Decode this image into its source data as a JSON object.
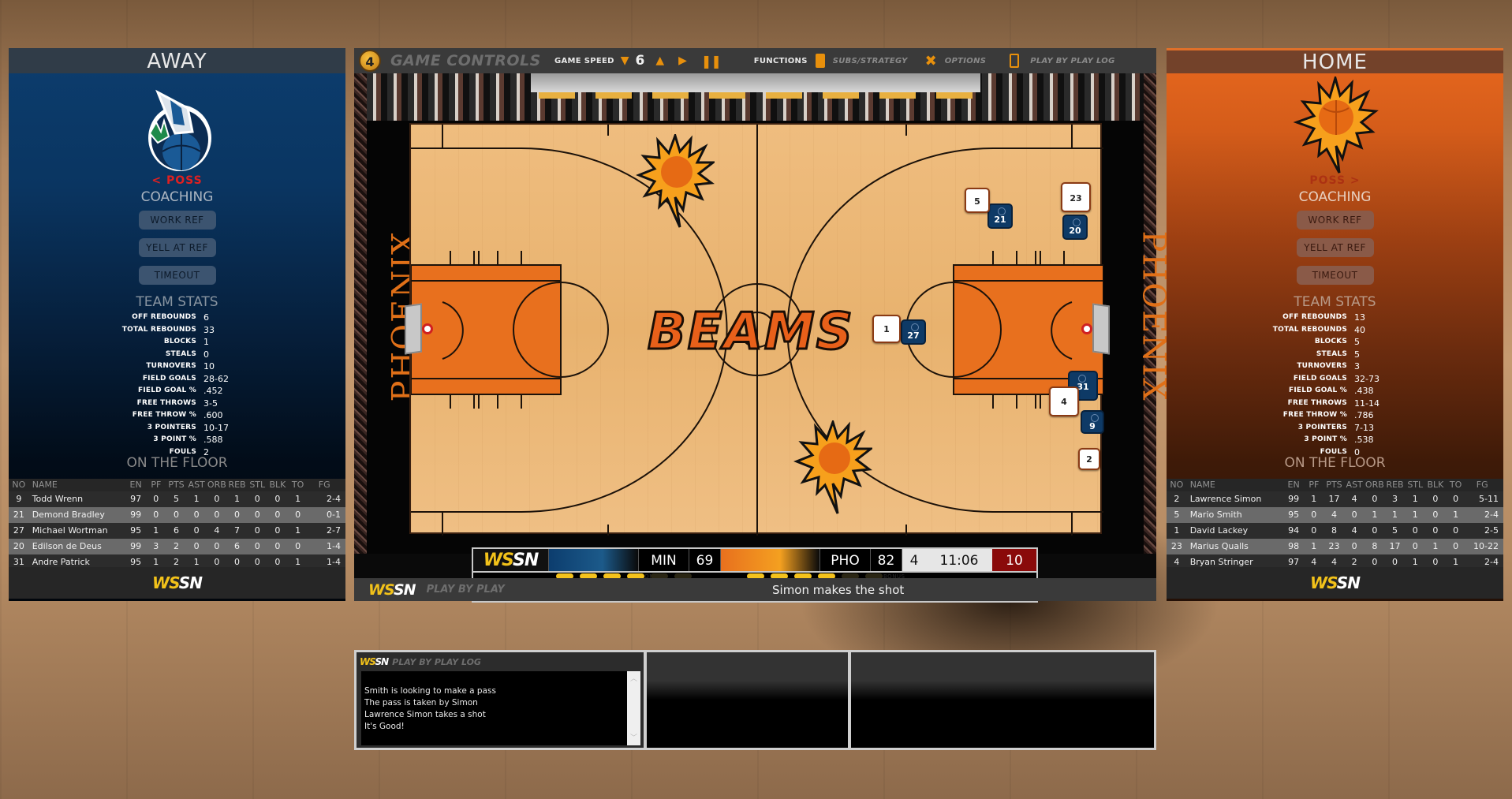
{
  "away": {
    "header": "AWAY",
    "logo": "wolf-basketball-logo",
    "possession": "< POSS",
    "coaching_title": "COACHING",
    "buttons": [
      "WORK REF",
      "YELL AT REF",
      "TIMEOUT"
    ],
    "team_stats_title": "TEAM STATS",
    "team_stats": [
      {
        "label": "OFF REBOUNDS",
        "value": "6"
      },
      {
        "label": "TOTAL REBOUNDS",
        "value": "33"
      },
      {
        "label": "BLOCKS",
        "value": "1"
      },
      {
        "label": "STEALS",
        "value": "0"
      },
      {
        "label": "TURNOVERS",
        "value": "10"
      },
      {
        "label": "FIELD GOALS",
        "value": "28-62"
      },
      {
        "label": "FIELD GOAL %",
        "value": ".452"
      },
      {
        "label": "FREE THROWS",
        "value": "3-5"
      },
      {
        "label": "FREE THROW %",
        "value": ".600"
      },
      {
        "label": "3 POINTERS",
        "value": "10-17"
      },
      {
        "label": "3 POINT %",
        "value": ".588"
      },
      {
        "label": "FOULS",
        "value": "2"
      }
    ],
    "on_floor_title": "ON THE FLOOR",
    "columns": [
      "NO",
      "NAME",
      "EN",
      "PF",
      "PTS",
      "AST",
      "ORB",
      "REB",
      "STL",
      "BLK",
      "TO",
      "FG"
    ],
    "players": [
      [
        "9",
        "Todd Wrenn",
        "97",
        "0",
        "5",
        "1",
        "0",
        "1",
        "0",
        "0",
        "1",
        "2-4"
      ],
      [
        "21",
        "Demond Bradley",
        "99",
        "0",
        "0",
        "0",
        "0",
        "0",
        "0",
        "0",
        "0",
        "0-1"
      ],
      [
        "27",
        "Michael Wortman",
        "95",
        "1",
        "6",
        "0",
        "4",
        "7",
        "0",
        "0",
        "1",
        "2-7"
      ],
      [
        "20",
        "Edilson de Deus",
        "99",
        "3",
        "2",
        "0",
        "0",
        "6",
        "0",
        "0",
        "0",
        "1-4"
      ],
      [
        "31",
        "Andre Patrick",
        "95",
        "1",
        "2",
        "1",
        "0",
        "0",
        "0",
        "0",
        "1",
        "1-4"
      ]
    ],
    "footer_brand": {
      "ws": "WS",
      "sn": "SN"
    }
  },
  "home": {
    "header": "HOME",
    "logo": "sun-basketball-logo",
    "possession": "POSS >",
    "coaching_title": "COACHING",
    "buttons": [
      "WORK REF",
      "YELL AT REF",
      "TIMEOUT"
    ],
    "team_stats_title": "TEAM STATS",
    "team_stats": [
      {
        "label": "OFF REBOUNDS",
        "value": "13"
      },
      {
        "label": "TOTAL REBOUNDS",
        "value": "40"
      },
      {
        "label": "BLOCKS",
        "value": "5"
      },
      {
        "label": "STEALS",
        "value": "5"
      },
      {
        "label": "TURNOVERS",
        "value": "3"
      },
      {
        "label": "FIELD GOALS",
        "value": "32-73"
      },
      {
        "label": "FIELD GOAL %",
        "value": ".438"
      },
      {
        "label": "FREE THROWS",
        "value": "11-14"
      },
      {
        "label": "FREE THROW %",
        "value": ".786"
      },
      {
        "label": "3 POINTERS",
        "value": "7-13"
      },
      {
        "label": "3 POINT %",
        "value": ".538"
      },
      {
        "label": "FOULS",
        "value": "0"
      }
    ],
    "on_floor_title": "ON THE FLOOR",
    "columns": [
      "NO",
      "NAME",
      "EN",
      "PF",
      "PTS",
      "AST",
      "ORB",
      "REB",
      "STL",
      "BLK",
      "TO",
      "FG"
    ],
    "players": [
      [
        "2",
        "Lawrence Simon",
        "99",
        "1",
        "17",
        "4",
        "0",
        "3",
        "1",
        "0",
        "0",
        "5-11"
      ],
      [
        "5",
        "Mario Smith",
        "95",
        "0",
        "4",
        "0",
        "1",
        "1",
        "1",
        "0",
        "1",
        "2-4"
      ],
      [
        "1",
        "David Lackey",
        "94",
        "0",
        "8",
        "4",
        "0",
        "5",
        "0",
        "0",
        "0",
        "2-5"
      ],
      [
        "23",
        "Marius Qualls",
        "98",
        "1",
        "23",
        "0",
        "8",
        "17",
        "0",
        "1",
        "0",
        "10-22"
      ],
      [
        "4",
        "Bryan Stringer",
        "97",
        "4",
        "4",
        "2",
        "0",
        "0",
        "1",
        "0",
        "1",
        "2-4"
      ]
    ],
    "footer_brand": {
      "ws": "WS",
      "sn": "SN"
    }
  },
  "controls": {
    "badge": "4",
    "title": "GAME CONTROLS",
    "game_speed_label": "GAME SPEED",
    "game_speed_value": "6",
    "speed_down_icon": "triangle-down",
    "speed_up_icon": "triangle-up",
    "play_icon": "play",
    "pause_icon": "pause",
    "functions_label": "FUNCTIONS",
    "subs_label": "SUBS/STRATEGY",
    "options_label": "OPTIONS",
    "log_label": "PLAY BY PLAY LOG",
    "accent_color": "#e8900c"
  },
  "court": {
    "center_logo": "BEAMS",
    "sideline_text": "PHOENIX",
    "home_players": [
      "5",
      "23",
      "1",
      "4",
      "2"
    ],
    "away_players": [
      "21",
      "20",
      "27",
      "31",
      "9"
    ]
  },
  "scoreboard": {
    "brand": {
      "ws": "WS",
      "sn": "SN"
    },
    "away_abbr": "MIN",
    "away_score": "69",
    "home_abbr": "PHO",
    "home_score": "82",
    "quarter": "4",
    "clock": "11:06",
    "shot_clock": "10",
    "bonus_label": "BONUS",
    "away_fouls": 4,
    "home_fouls": 4,
    "foul_slots": 6
  },
  "play_by_play": {
    "brand": {
      "ws": "WS",
      "sn": "SN"
    },
    "label": "PLAY BY PLAY",
    "message": "Simon makes the shot"
  },
  "log": {
    "brand": {
      "ws": "WS",
      "sn": "SN"
    },
    "title": "PLAY BY PLAY LOG",
    "lines": [
      "Smith is looking to make a pass",
      "The pass is taken by Simon",
      "Lawrence Simon takes a shot",
      "It's Good!"
    ]
  }
}
